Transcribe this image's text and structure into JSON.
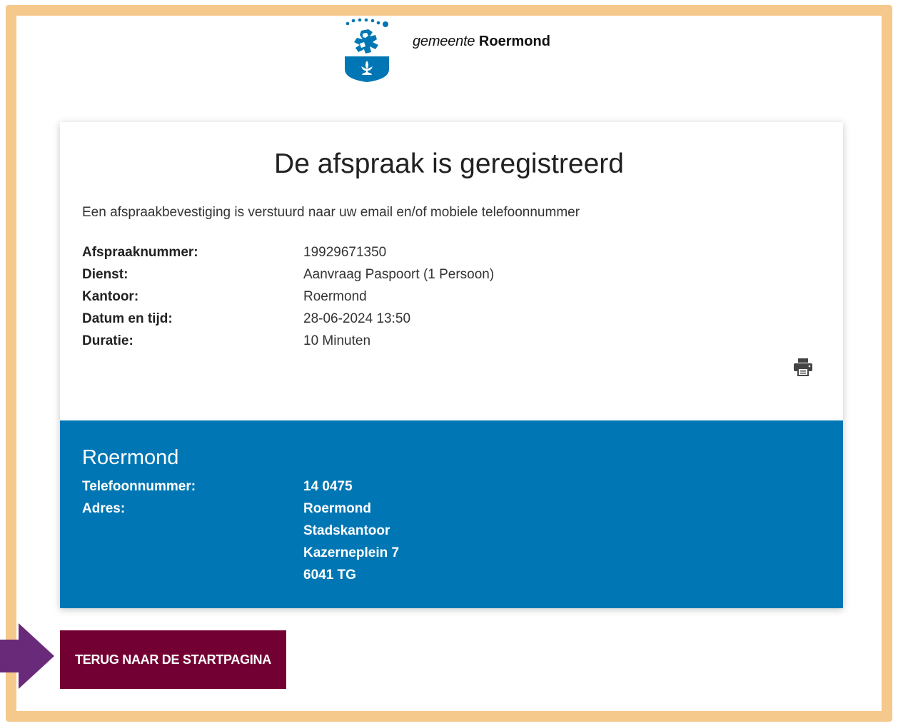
{
  "brand": {
    "prefix": "gemeente",
    "name": "Roermond",
    "logo_icon": "roermond-coat-of-arms-icon"
  },
  "confirmation": {
    "title": "De afspraak is geregistreerd",
    "intro": "Een afspraakbevestiging is verstuurd naar uw email en/of mobiele telefoonnummer",
    "details": [
      {
        "label": "Afspraaknummer:",
        "value": "19929671350"
      },
      {
        "label": "Dienst:",
        "value": "Aanvraag Paspoort (1 Persoon)"
      },
      {
        "label": "Kantoor:",
        "value": "Roermond"
      },
      {
        "label": "Datum en tijd:",
        "value": "28-06-2024 13:50"
      },
      {
        "label": "Duratie:",
        "value": "10 Minuten"
      }
    ],
    "print_icon": "printer-icon"
  },
  "office": {
    "name": "Roermond",
    "phone_label": "Telefoonnummer:",
    "phone": "14 0475",
    "address_label": "Adres:",
    "address_lines": [
      "Roermond",
      "Stadskantoor",
      "Kazerneplein 7",
      "6041 TG"
    ]
  },
  "actions": {
    "back_label": "TERUG NAAR DE STARTPAGINA"
  },
  "colors": {
    "frame": "#f5c88b",
    "office_bg": "#0077b4",
    "button_bg": "#730032",
    "arrow": "#6a2a7a"
  }
}
